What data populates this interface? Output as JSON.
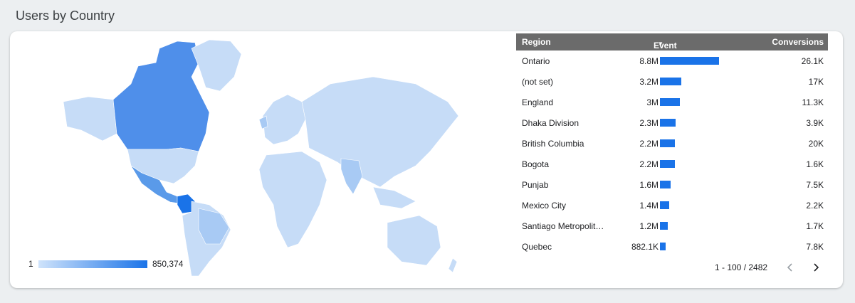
{
  "title": "Users by Country",
  "legend": {
    "min": "1",
    "max": "850,374"
  },
  "table": {
    "headers": {
      "region": "Region",
      "event": "Event count",
      "sort_icon": "▼",
      "conversions": "Conversions"
    },
    "rows": [
      {
        "region": "Ontario",
        "event": "8.8M",
        "conv": "26.1K",
        "value": 8.8
      },
      {
        "region": "(not set)",
        "event": "3.2M",
        "conv": "17K",
        "value": 3.2
      },
      {
        "region": "England",
        "event": "3M",
        "conv": "11.3K",
        "value": 3.0
      },
      {
        "region": "Dhaka Division",
        "event": "2.3M",
        "conv": "3.9K",
        "value": 2.3
      },
      {
        "region": "British Columbia",
        "event": "2.2M",
        "conv": "20K",
        "value": 2.2
      },
      {
        "region": "Bogota",
        "event": "2.2M",
        "conv": "1.6K",
        "value": 2.2
      },
      {
        "region": "Punjab",
        "event": "1.6M",
        "conv": "7.5K",
        "value": 1.6
      },
      {
        "region": "Mexico City",
        "event": "1.4M",
        "conv": "2.2K",
        "value": 1.4
      },
      {
        "region": "Santiago Metropolit…",
        "event": "1.2M",
        "conv": "1.7K",
        "value": 1.2
      },
      {
        "region": "Quebec",
        "event": "882.1K",
        "conv": "7.8K",
        "value": 0.8821
      }
    ],
    "pagination": "1 - 100 / 2482"
  },
  "colors": {
    "accent": "#1a73e8",
    "land_light": "#c6dcf7",
    "land_mid": "#5a9ae9",
    "header_bg": "#6b6b6b"
  }
}
